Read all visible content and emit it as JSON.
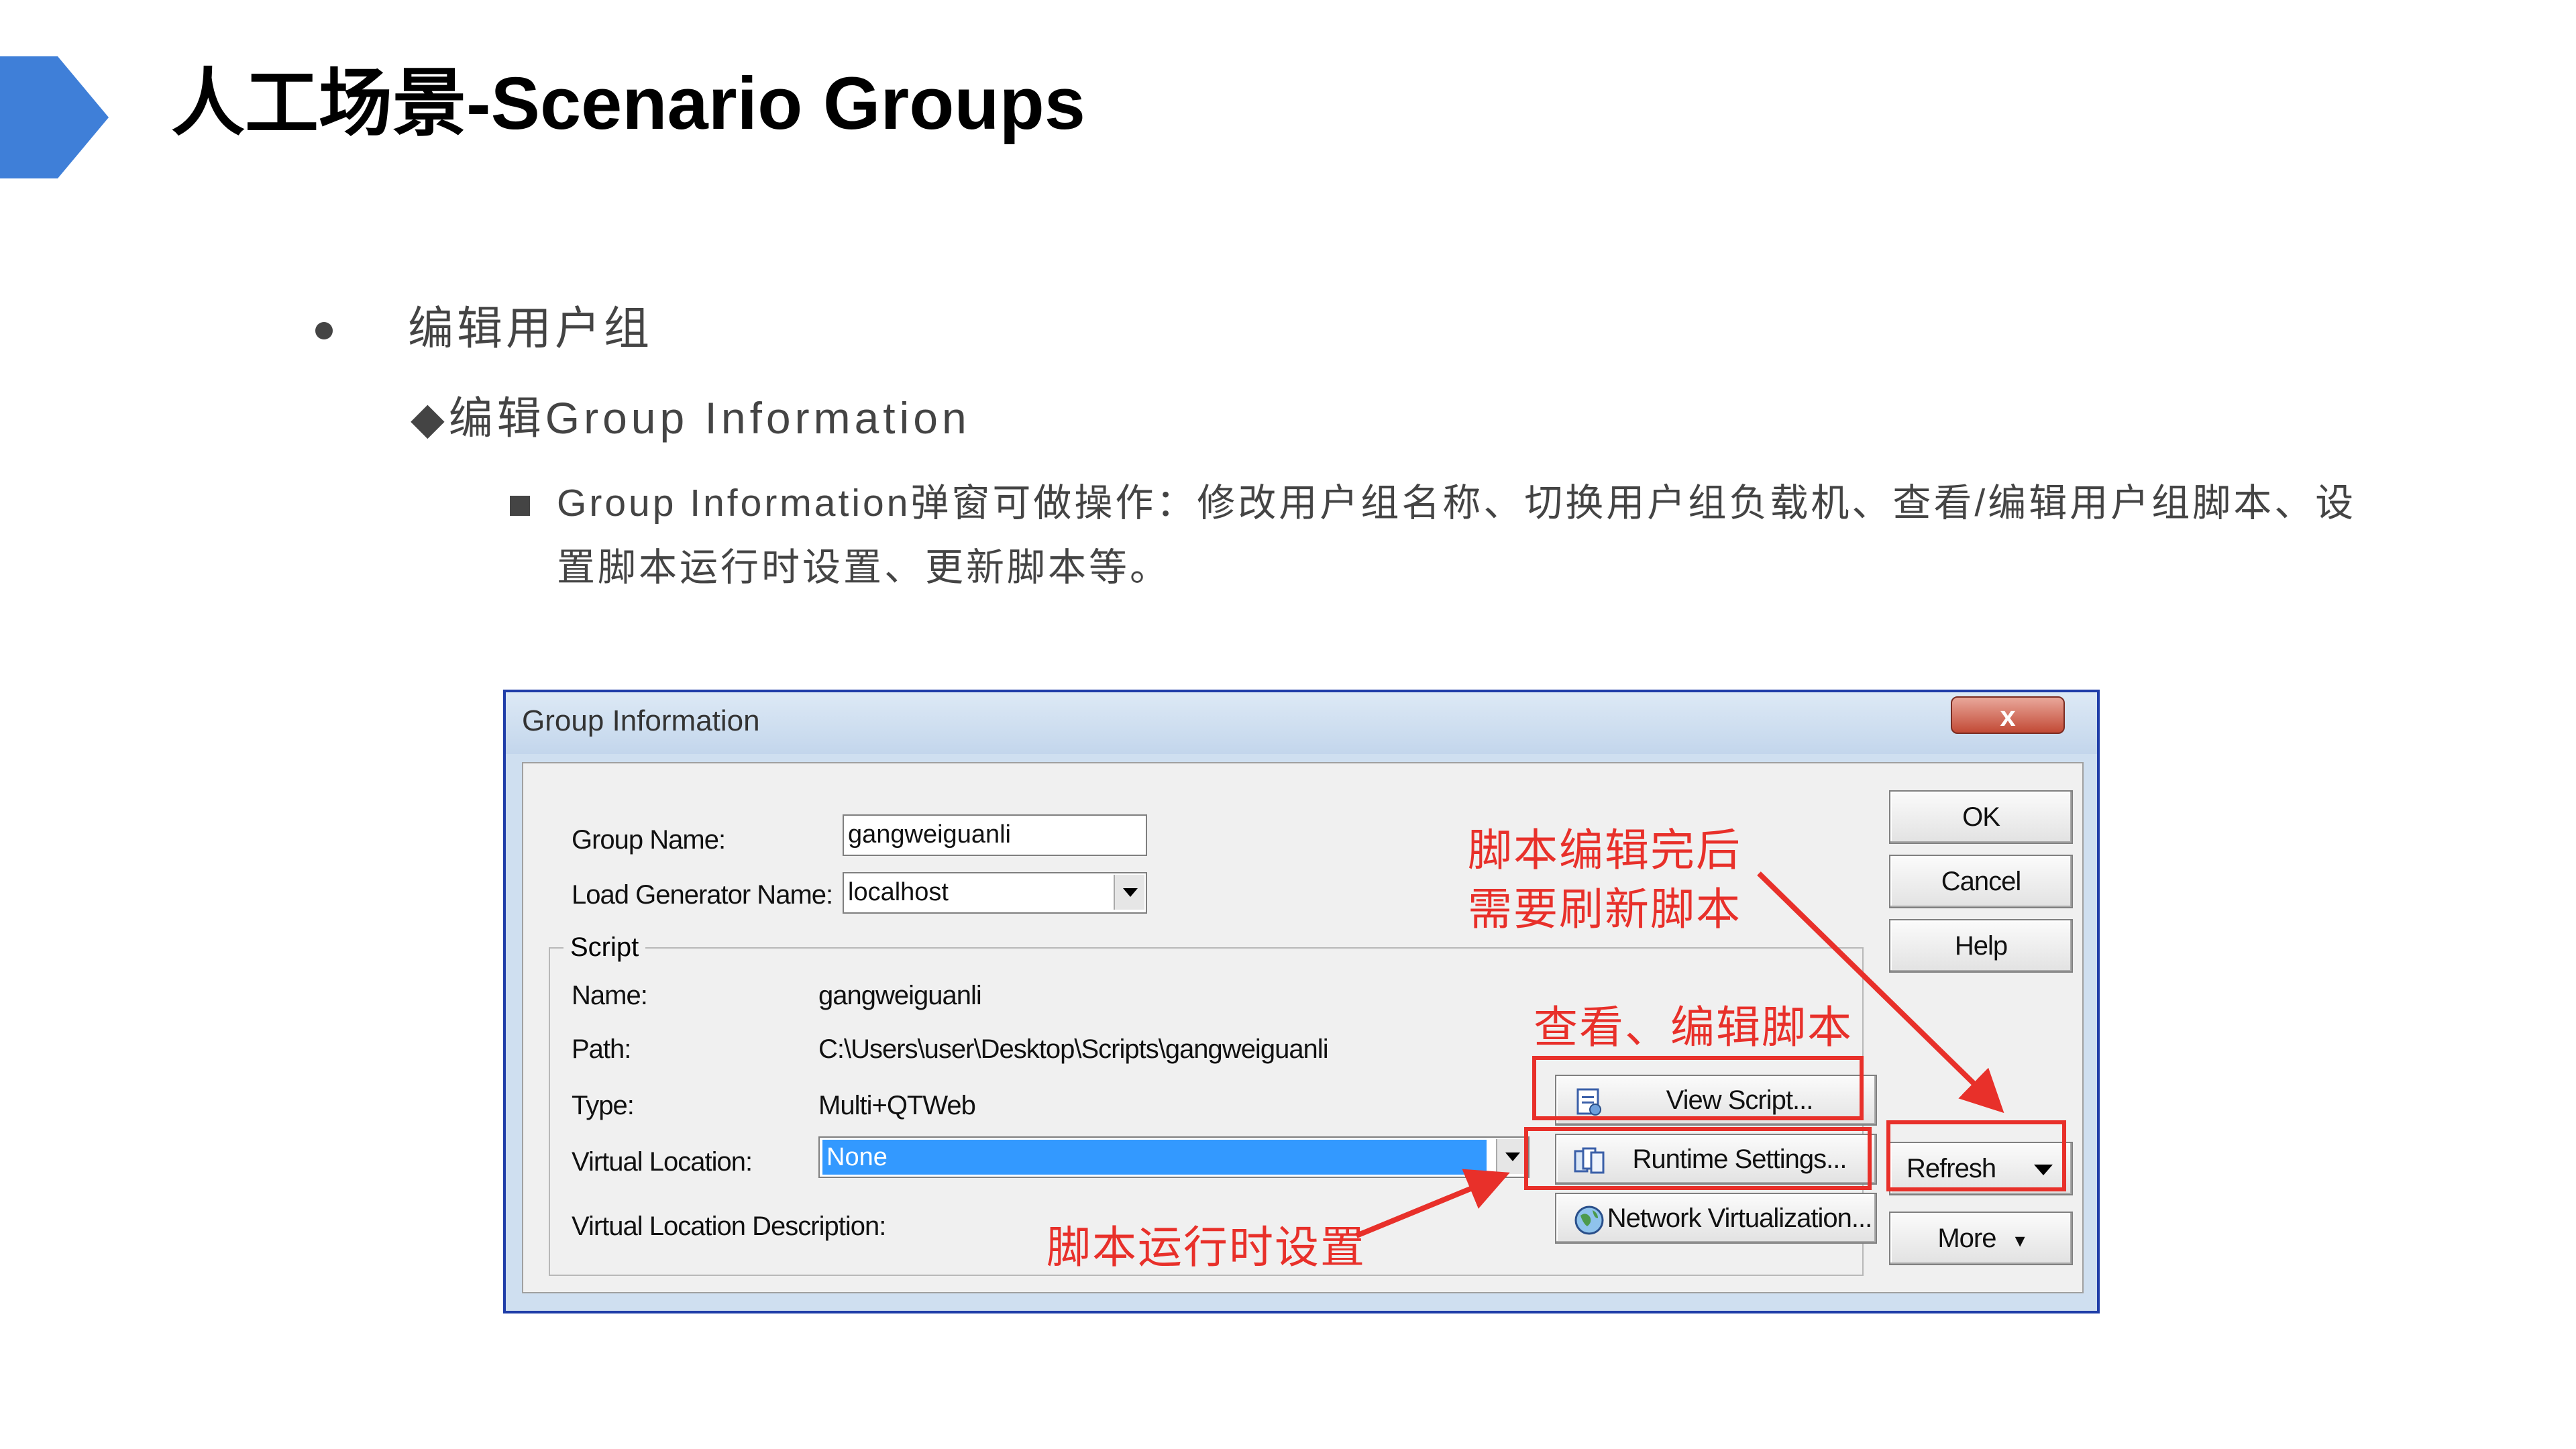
{
  "slide": {
    "title": "人工场景-Scenario Groups",
    "bullet1": "编辑用户组",
    "bullet2": "◆编辑Group Information",
    "bullet3_line1": "Group Information弹窗可做操作：修改用户组名称、切换用户组负载机、查看/编辑用户组脚本、设",
    "bullet3_line2": "置脚本运行时设置、更新脚本等。"
  },
  "dialog": {
    "title": "Group Information",
    "close_label": "x",
    "group_name_label": "Group Name:",
    "group_name_value": "gangweiguanli",
    "load_generator_label": "Load Generator Name:",
    "load_generator_value": "localhost",
    "script_group_title": "Script",
    "name_label": "Name:",
    "name_value": "gangweiguanli",
    "path_label": "Path:",
    "path_value": "C:\\Users\\user\\Desktop\\Scripts\\gangweiguanli",
    "type_label": "Type:",
    "type_value": "Multi+QTWeb",
    "virtual_location_label": "Virtual Location:",
    "virtual_location_value": "None",
    "virtual_location_desc_label": "Virtual Location Description:",
    "buttons": {
      "ok": "OK",
      "cancel": "Cancel",
      "help": "Help",
      "view_script": "View Script...",
      "runtime_settings": "Runtime Settings...",
      "network_virtualization": "Network Virtualization...",
      "refresh": "Refresh",
      "more": "More"
    }
  },
  "annotations": {
    "refresh_note_line1": "脚本编辑完后",
    "refresh_note_line2": "需要刷新脚本",
    "view_note": "查看、编辑脚本",
    "runtime_note": "脚本运行时设置"
  },
  "colors": {
    "accent_blue": "#3f7fd8",
    "annotation_red": "#e8302a",
    "selection_blue": "#3399ff"
  }
}
